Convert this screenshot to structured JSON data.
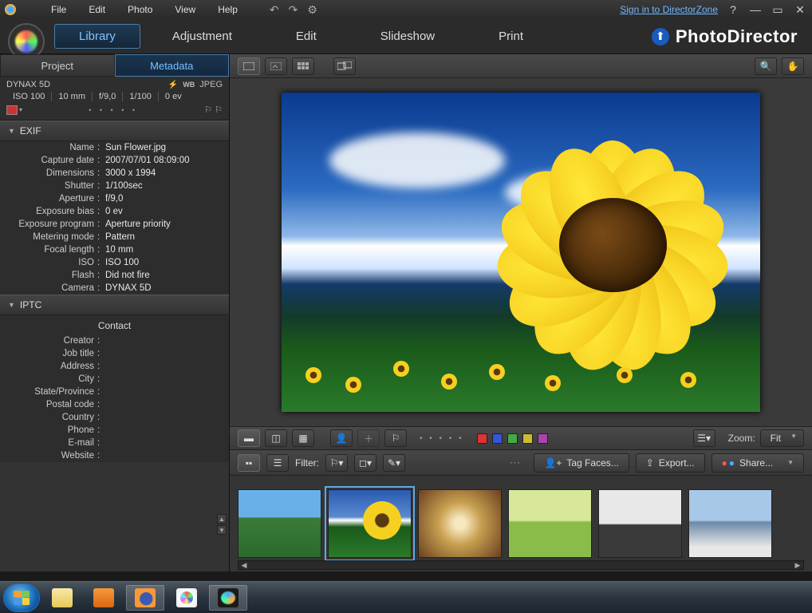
{
  "menu": {
    "file": "File",
    "edit": "Edit",
    "photo": "Photo",
    "view": "View",
    "help": "Help",
    "signin": "Sign in to DirectorZone"
  },
  "modules": {
    "library": "Library",
    "adjustment": "Adjustment",
    "edit": "Edit",
    "slideshow": "Slideshow",
    "print": "Print"
  },
  "brand": "PhotoDirector",
  "lefttabs": {
    "project": "Project",
    "metadata": "Metadata"
  },
  "cam": {
    "model": "DYNAX 5D",
    "format": "JPEG",
    "iso": "ISO 100",
    "focal": "10 mm",
    "ap": "f/9,0",
    "shutter": "1/100",
    "ev": "0 ev"
  },
  "sect": {
    "exif": "EXIF",
    "iptc": "IPTC",
    "contact": "Contact"
  },
  "exif": [
    {
      "k": "Name",
      "v": "Sun Flower.jpg"
    },
    {
      "k": "Capture date",
      "v": "2007/07/01 08:09:00"
    },
    {
      "k": "Dimensions",
      "v": "3000 x 1994"
    },
    {
      "k": "Shutter",
      "v": "1/100sec"
    },
    {
      "k": "Aperture",
      "v": "f/9,0"
    },
    {
      "k": "Exposure bias",
      "v": "0 ev"
    },
    {
      "k": "Exposure program",
      "v": "Aperture priority"
    },
    {
      "k": "Metering mode",
      "v": "Pattern"
    },
    {
      "k": "Focal length",
      "v": "10 mm"
    },
    {
      "k": "ISO",
      "v": "ISO 100"
    },
    {
      "k": "Flash",
      "v": "Did not fire"
    },
    {
      "k": "Camera",
      "v": "DYNAX 5D"
    }
  ],
  "iptc": [
    {
      "k": "Creator",
      "v": ""
    },
    {
      "k": "Job title",
      "v": ""
    },
    {
      "k": "Address",
      "v": ""
    },
    {
      "k": "City",
      "v": ""
    },
    {
      "k": "State/Province",
      "v": ""
    },
    {
      "k": "Postal code",
      "v": ""
    },
    {
      "k": "Country",
      "v": ""
    },
    {
      "k": "Phone",
      "v": ""
    },
    {
      "k": "E-mail",
      "v": ""
    },
    {
      "k": "Website",
      "v": ""
    }
  ],
  "zoom": {
    "label": "Zoom:",
    "value": "Fit"
  },
  "filter": {
    "label": "Filter:"
  },
  "actions": {
    "tagfaces": "Tag Faces...",
    "export": "Export...",
    "share": "Share..."
  }
}
